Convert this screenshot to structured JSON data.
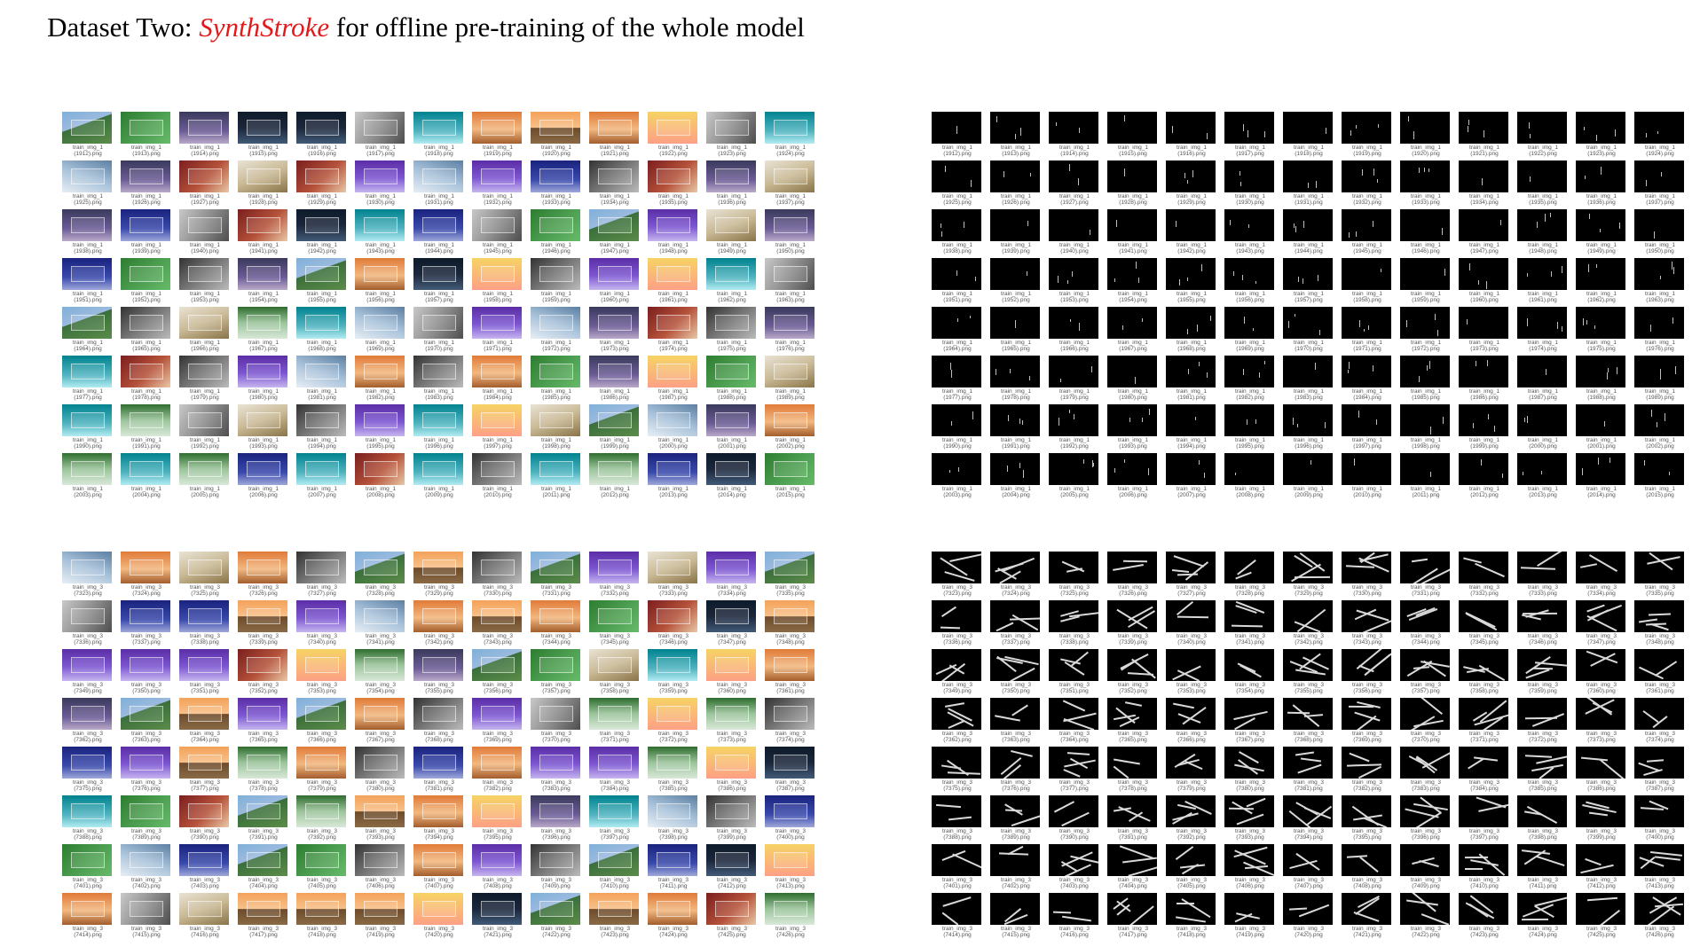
{
  "title": {
    "prefix": "Dataset Two: ",
    "highlight": "SynthStroke",
    "suffix": " for offline pre-training of the whole model"
  },
  "panels": {
    "top_left": {
      "kind": "photo",
      "label_prefix": "train_img_1",
      "start": 1912,
      "end": 2015
    },
    "top_right": {
      "kind": "mask-sparse",
      "label_prefix": "train_img_1",
      "start": 1912,
      "end": 2015
    },
    "bottom_left": {
      "kind": "photo",
      "label_prefix": "train_img_3",
      "start": 7323,
      "end": 7426
    },
    "bottom_right": {
      "kind": "mask-text",
      "label_prefix": "train_img_3",
      "start": 7323,
      "end": 7426
    }
  },
  "grid": {
    "columns": 13,
    "rows": 8
  },
  "file_extension": ".png",
  "colors": {
    "highlight": "#e3191b",
    "caption": "#555555",
    "mask_background": "#000000"
  }
}
